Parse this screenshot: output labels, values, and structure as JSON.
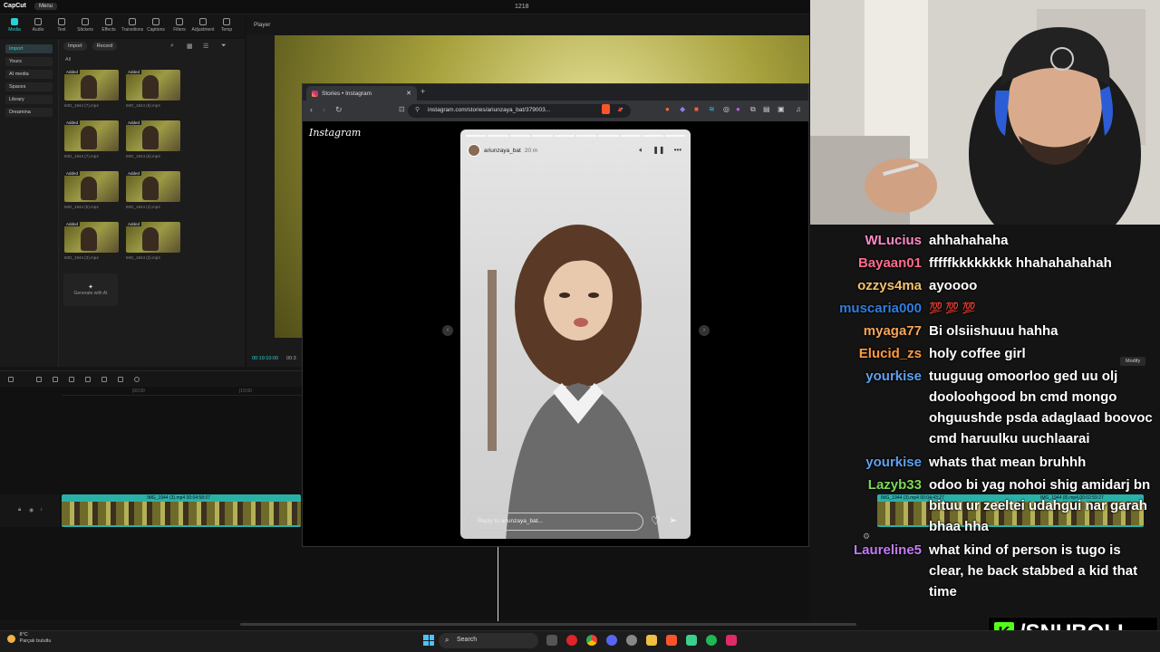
{
  "capcut": {
    "logo": "CapCut",
    "menu": "Menu",
    "title": "1218",
    "tools": [
      "Media",
      "Audio",
      "Text",
      "Stickers",
      "Effects",
      "Transitions",
      "Captions",
      "Filters",
      "Adjustment",
      "Temp"
    ],
    "side": [
      "Import",
      "Yours",
      "AI media",
      "Spaces",
      "Library",
      "Dreamina"
    ],
    "import_btn": "Import",
    "record_btn": "Record",
    "all_label": "All",
    "thumbs": [
      {
        "tag": "Added",
        "name": "IMG_1944 (7).mp4"
      },
      {
        "tag": "Added",
        "name": "IMG_1944 (8).mp4"
      },
      {
        "tag": "Added",
        "name": "IMG_1944 (7).mp4"
      },
      {
        "tag": "Added",
        "name": "IMG_1944 (6).mp4"
      },
      {
        "tag": "Added",
        "name": "IMG_1944 (5).mp4"
      },
      {
        "tag": "Added",
        "name": "IMG_1944 (4).mp4"
      },
      {
        "tag": "Added",
        "name": "IMG_1944 (3).mp4"
      },
      {
        "tag": "Added",
        "name": "IMG_1944 (2).mp4"
      }
    ],
    "generate": "Generate with AI",
    "player_label": "Player",
    "player_time": "00:19:10:00",
    "player_time_trunc": "00:3",
    "ruler": [
      "|00:00",
      "|10:00"
    ],
    "clip_label": "IMG_1944 (3).mp4 00:04:58:07",
    "clip2_a": "IMG_1944 (3).mp4 00:04:43:27",
    "clip2_b": "IMG_1944 (8).mp4 00:02:59:27",
    "modify": "Modify"
  },
  "browser": {
    "tab_title": "Stories • Instagram",
    "url": "instagram.com/stories/ariunzaya_bat/379003...",
    "page_logo": "Instagram",
    "story": {
      "username": "ariunzaya_bat",
      "time": "20 m",
      "reply_placeholder": "Reply to ariunzaya_bat..."
    }
  },
  "chat": [
    {
      "user": "WLucius",
      "color": "#ff8ac8",
      "text": "ahhahahaha"
    },
    {
      "user": "Bayaan01",
      "color": "#ff6b8b",
      "text": "fffffkkkkkkkk hhahahahahah"
    },
    {
      "user": "ozzys4ma",
      "color": "#f5c06a",
      "text": "ayoooo"
    },
    {
      "user": "muscaria000",
      "color": "#2f7fe0",
      "text": "💯 💯 💯"
    },
    {
      "user": "myaga77",
      "color": "#f5a65b",
      "text": "Bi olsiishuuu hahha"
    },
    {
      "user": "Elucid_zs",
      "color": "#ff9a3c",
      "text": "holy coffee girl"
    },
    {
      "user": "yourkise",
      "color": "#5fa0f0",
      "text": "tuuguug omoorloo ged uu olj dooloohgood bn cmd mongo ohguushde psda adaglaad boovoc cmd haruulku uuchlaarai"
    },
    {
      "user": "yourkise",
      "color": "#5fa0f0",
      "text": "whats that mean bruhhh"
    },
    {
      "user": "Lazyb33",
      "color": "#7ed957",
      "text": "odoo bi yag nohoi shig amidarj bn bituu ur zeeltei udahgui nar garah bhaa hha"
    },
    {
      "user": "Laureline5",
      "color": "#c27cf5",
      "text": "what kind of person is tugo is clear, he back stabbed a kid that time"
    }
  ],
  "overlay": {
    "brand": "/SNUBOLI",
    "kick_letter": "K"
  },
  "taskbar": {
    "temp": "8°C",
    "weather": "Parçalı bulutlu",
    "search": "Search"
  }
}
